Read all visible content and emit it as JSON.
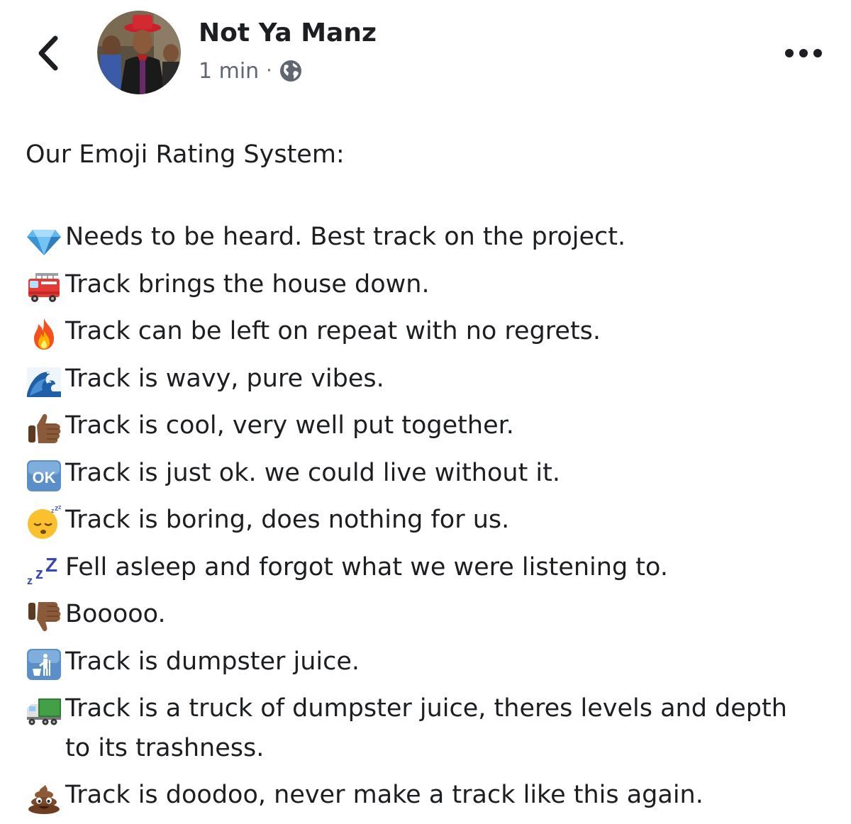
{
  "header": {
    "author_name": "Not Ya Manz",
    "timestamp": "1 min",
    "separator": "·"
  },
  "post": {
    "title": "Our Emoji Rating System:",
    "ratings": [
      {
        "icon": "gem-icon",
        "text": "Needs to be heard. Best track on the project."
      },
      {
        "icon": "fire-engine-icon",
        "text": "Track brings the house down."
      },
      {
        "icon": "fire-icon",
        "text": "Track can be left on repeat with no regrets."
      },
      {
        "icon": "wave-icon",
        "text": "Track is wavy, pure vibes."
      },
      {
        "icon": "thumbs-up-icon",
        "text": "Track is cool, very well put together."
      },
      {
        "icon": "ok-button-icon",
        "text": "Track is just ok. we could live without it."
      },
      {
        "icon": "sleeping-face-icon",
        "text": "Track is boring, does nothing for us."
      },
      {
        "icon": "zzz-icon",
        "text": "Fell asleep and forgot what we were listening to."
      },
      {
        "icon": "thumbs-down-icon",
        "text": "Booooo."
      },
      {
        "icon": "litter-bin-icon",
        "text": "Track is dumpster juice."
      },
      {
        "icon": "delivery-truck-icon",
        "text": "Track is a truck of dumpster juice, theres levels and depth to its trashness."
      },
      {
        "icon": "pile-of-poo-icon",
        "text": "Track is doodoo, never make a track like this again."
      }
    ]
  },
  "colors": {
    "text": "#1c1e21",
    "meta": "#606770",
    "back_chevron": "#1c1e21"
  }
}
